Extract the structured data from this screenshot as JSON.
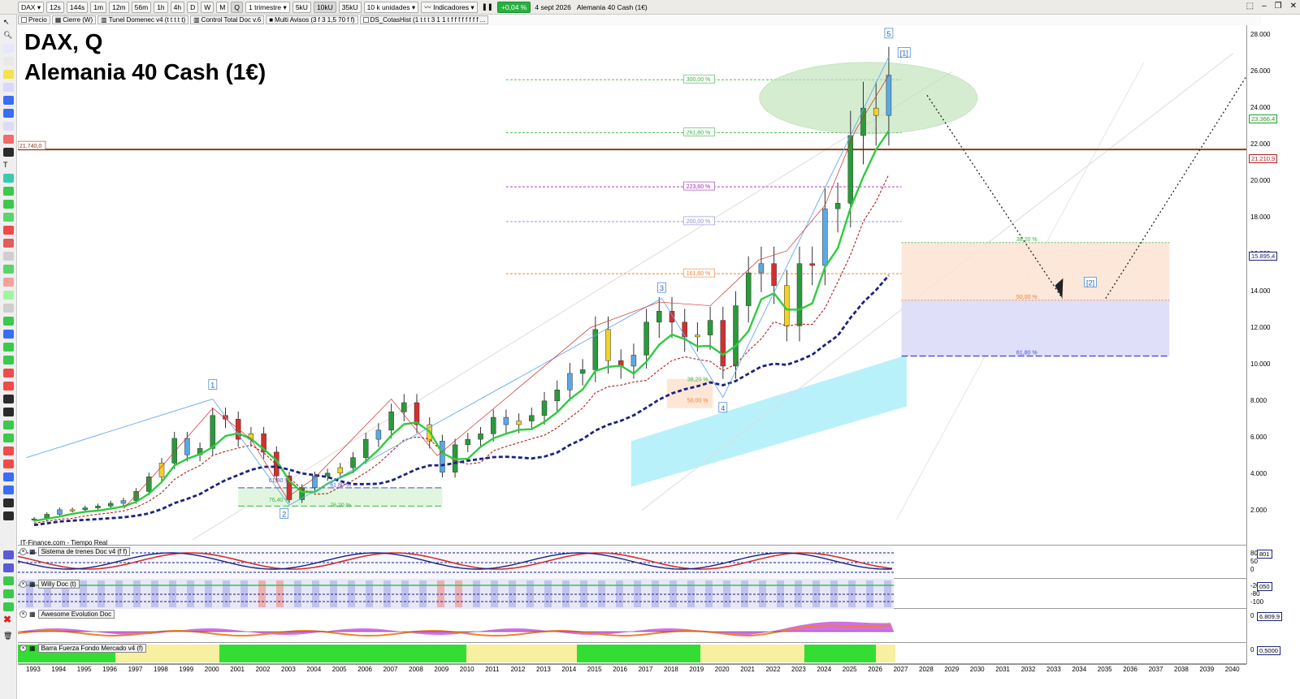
{
  "toolbar": {
    "symbol": "DAX",
    "timeframes": [
      "12s",
      "144s",
      "1m",
      "12m",
      "56m",
      "1h",
      "4h",
      "D",
      "W",
      "M",
      "Q"
    ],
    "active_timeframe": "Q",
    "period_select": "1 trimestre",
    "volume_units": [
      "5kU",
      "10kU",
      "35kU"
    ],
    "active_volume_unit": "10kU",
    "unit_select": "10 k unidades",
    "indicators_label": "Indicadores",
    "change_pct": "+0,04 %",
    "date": "4 sept 2026",
    "instrument": "Alemania 40 Cash (1€)"
  },
  "indicator_bar": [
    "Precio",
    "Cierre (W)",
    "Tunel Domenec v4 (t t t t t)",
    "Control Total Doc v.6",
    "Multi Avisos (3 f 3 1,5 70 f f)",
    "DS_CotasHist (1 t t t 3 1 1 t f f f f f f f f ..."
  ],
  "title": {
    "line1": "DAX, Q",
    "line2": "Alemania 40 Cash (1€)"
  },
  "source_label": "IT-Finance.com - Tiempo Real",
  "price_axis": {
    "ticks": [
      "28.000",
      "26.000",
      "24.000",
      "22.000",
      "20.000",
      "18.000",
      "16.000",
      "14.000",
      "12.000",
      "10.000",
      "8.000",
      "6.000",
      "4.000",
      "2.000"
    ],
    "tick_values": [
      28000,
      26000,
      24000,
      22000,
      20000,
      18000,
      16000,
      14000,
      12000,
      10000,
      8000,
      6000,
      4000,
      2000
    ],
    "labels": [
      {
        "text": "23.366,4",
        "color": "#22a02a",
        "value": 23366
      },
      {
        "text": "21.210,9",
        "color": "#b01e1e",
        "value": 21211
      },
      {
        "text": "15.895,4",
        "color": "#1a237e",
        "value": 15895
      }
    ]
  },
  "horizontal_line": {
    "label": "21.740,0",
    "value": 21740,
    "color": "#8b3a1a"
  },
  "fib_levels_upper": [
    {
      "label": "300,00 %",
      "value": 25550,
      "color": "#3cb043"
    },
    {
      "label": "261,80 %",
      "value": 22650,
      "color": "#3cb043"
    },
    {
      "label": "223,60 %",
      "value": 19700,
      "color": "#9c27b0"
    },
    {
      "label": "200,00 %",
      "value": 17800,
      "color": "#8a8ad8"
    },
    {
      "label": "161,80 %",
      "value": 14950,
      "color": "#f08030"
    }
  ],
  "fib_zone_right": [
    {
      "label": "38,20 %",
      "value": 16650,
      "color": "#3cb043"
    },
    {
      "label": "50,00 %",
      "value": 13500,
      "color": "#f08030"
    },
    {
      "label": "61,80 %",
      "value": 10450,
      "color": "#4a4ad8"
    }
  ],
  "fib_zone_2018": [
    {
      "label": "38,20 %",
      "value": 9200,
      "color": "#3cb043"
    },
    {
      "label": "50,00 %",
      "value": 8050,
      "color": "#f08030"
    }
  ],
  "fib_zone_2003": [
    {
      "label": "61,80 %",
      "value": 3250,
      "color": "#4a4ad8"
    },
    {
      "label": "76,40 %",
      "value": 2450,
      "color": "#3cb043"
    },
    {
      "label": "61,80 %",
      "value": 3250,
      "color": "#4a4ad8"
    },
    {
      "label": "76,20 %",
      "value": 2450,
      "color": "#3cb043"
    }
  ],
  "wave_labels": [
    "1",
    "2",
    "3",
    "4",
    "5",
    "[1]",
    "[2]"
  ],
  "subpanels": [
    {
      "name": "Sistema de trenes Doc v4 (f f)",
      "ticks": [
        "80",
        "50",
        "0"
      ],
      "label": "801"
    },
    {
      "name": "Willy Doc (t)",
      "ticks": [
        "-20",
        "-80",
        "-100"
      ],
      "label": "050"
    },
    {
      "name": "Awesome Evolution Doc",
      "ticks": [
        "0"
      ],
      "label": "6.809,9"
    },
    {
      "name": "Barra Fuerza Fondo Mercado v4 (f)",
      "ticks": [
        "0"
      ],
      "label": "0,5000"
    }
  ],
  "years": [
    "1993",
    "1994",
    "1995",
    "1996",
    "1997",
    "1998",
    "1999",
    "2000",
    "2001",
    "2002",
    "2003",
    "2004",
    "2005",
    "2006",
    "2007",
    "2008",
    "2009",
    "2010",
    "2011",
    "2012",
    "2013",
    "2014",
    "2015",
    "2016",
    "2017",
    "2018",
    "2019",
    "2020",
    "2021",
    "2022",
    "2023",
    "2024",
    "2025",
    "2026",
    "2027",
    "2028",
    "2029",
    "2030",
    "2031",
    "2032",
    "2033",
    "2034",
    "2035",
    "2036",
    "2037",
    "2038",
    "2039",
    "2040"
  ],
  "chart_data": {
    "type": "candlestick",
    "title": "DAX, Q",
    "subtitle": "Alemania 40 Cash (1€)",
    "xlabel": "",
    "ylabel": "",
    "ylim": [
      0,
      28600
    ],
    "x_range": [
      "1992.7",
      "2040.3"
    ],
    "quarter_close": [
      [
        1993.0,
        1550
      ],
      [
        1993.5,
        1800
      ],
      [
        1994.0,
        2050
      ],
      [
        1994.5,
        2050
      ],
      [
        1995.0,
        2150
      ],
      [
        1995.5,
        2250
      ],
      [
        1996.0,
        2400
      ],
      [
        1996.5,
        2550
      ],
      [
        1997.0,
        3050
      ],
      [
        1997.5,
        3850
      ],
      [
        1998.0,
        4600
      ],
      [
        1998.5,
        5950
      ],
      [
        1999.0,
        5050
      ],
      [
        1999.5,
        5400
      ],
      [
        2000.0,
        7200
      ],
      [
        2000.5,
        7000
      ],
      [
        2001.0,
        5900
      ],
      [
        2001.5,
        6200
      ],
      [
        2002.0,
        5200
      ],
      [
        2002.5,
        3900
      ],
      [
        2003.0,
        2600
      ],
      [
        2003.5,
        3250
      ],
      [
        2004.0,
        3900
      ],
      [
        2004.5,
        4050
      ],
      [
        2005.0,
        4350
      ],
      [
        2005.5,
        4900
      ],
      [
        2006.0,
        5900
      ],
      [
        2006.5,
        6400
      ],
      [
        2007.0,
        7400
      ],
      [
        2007.5,
        7900
      ],
      [
        2008.0,
        6700
      ],
      [
        2008.5,
        5800
      ],
      [
        2009.0,
        4100
      ],
      [
        2009.5,
        5600
      ],
      [
        2010.0,
        5900
      ],
      [
        2010.5,
        6200
      ],
      [
        2011.0,
        7100
      ],
      [
        2011.5,
        6700
      ],
      [
        2012.0,
        6900
      ],
      [
        2012.5,
        7200
      ],
      [
        2013.0,
        8000
      ],
      [
        2013.5,
        8600
      ],
      [
        2014.0,
        9500
      ],
      [
        2014.5,
        9700
      ],
      [
        2015.0,
        11900
      ],
      [
        2015.5,
        10200
      ],
      [
        2016.0,
        9900
      ],
      [
        2016.5,
        10500
      ],
      [
        2017.0,
        12300
      ],
      [
        2017.5,
        12900
      ],
      [
        2018.0,
        12300
      ],
      [
        2018.5,
        11500
      ],
      [
        2019.0,
        11600
      ],
      [
        2019.5,
        12400
      ],
      [
        2020.0,
        9900
      ],
      [
        2020.5,
        13200
      ],
      [
        2021.0,
        15000
      ],
      [
        2021.5,
        15500
      ],
      [
        2022.0,
        14300
      ],
      [
        2022.5,
        12100
      ],
      [
        2023.0,
        15500
      ],
      [
        2023.5,
        15400
      ],
      [
        2024.0,
        18500
      ],
      [
        2024.5,
        18800
      ],
      [
        2025.0,
        22500
      ],
      [
        2025.5,
        24000
      ],
      [
        2026.0,
        23600
      ],
      [
        2026.5,
        25800
      ]
    ]
  }
}
